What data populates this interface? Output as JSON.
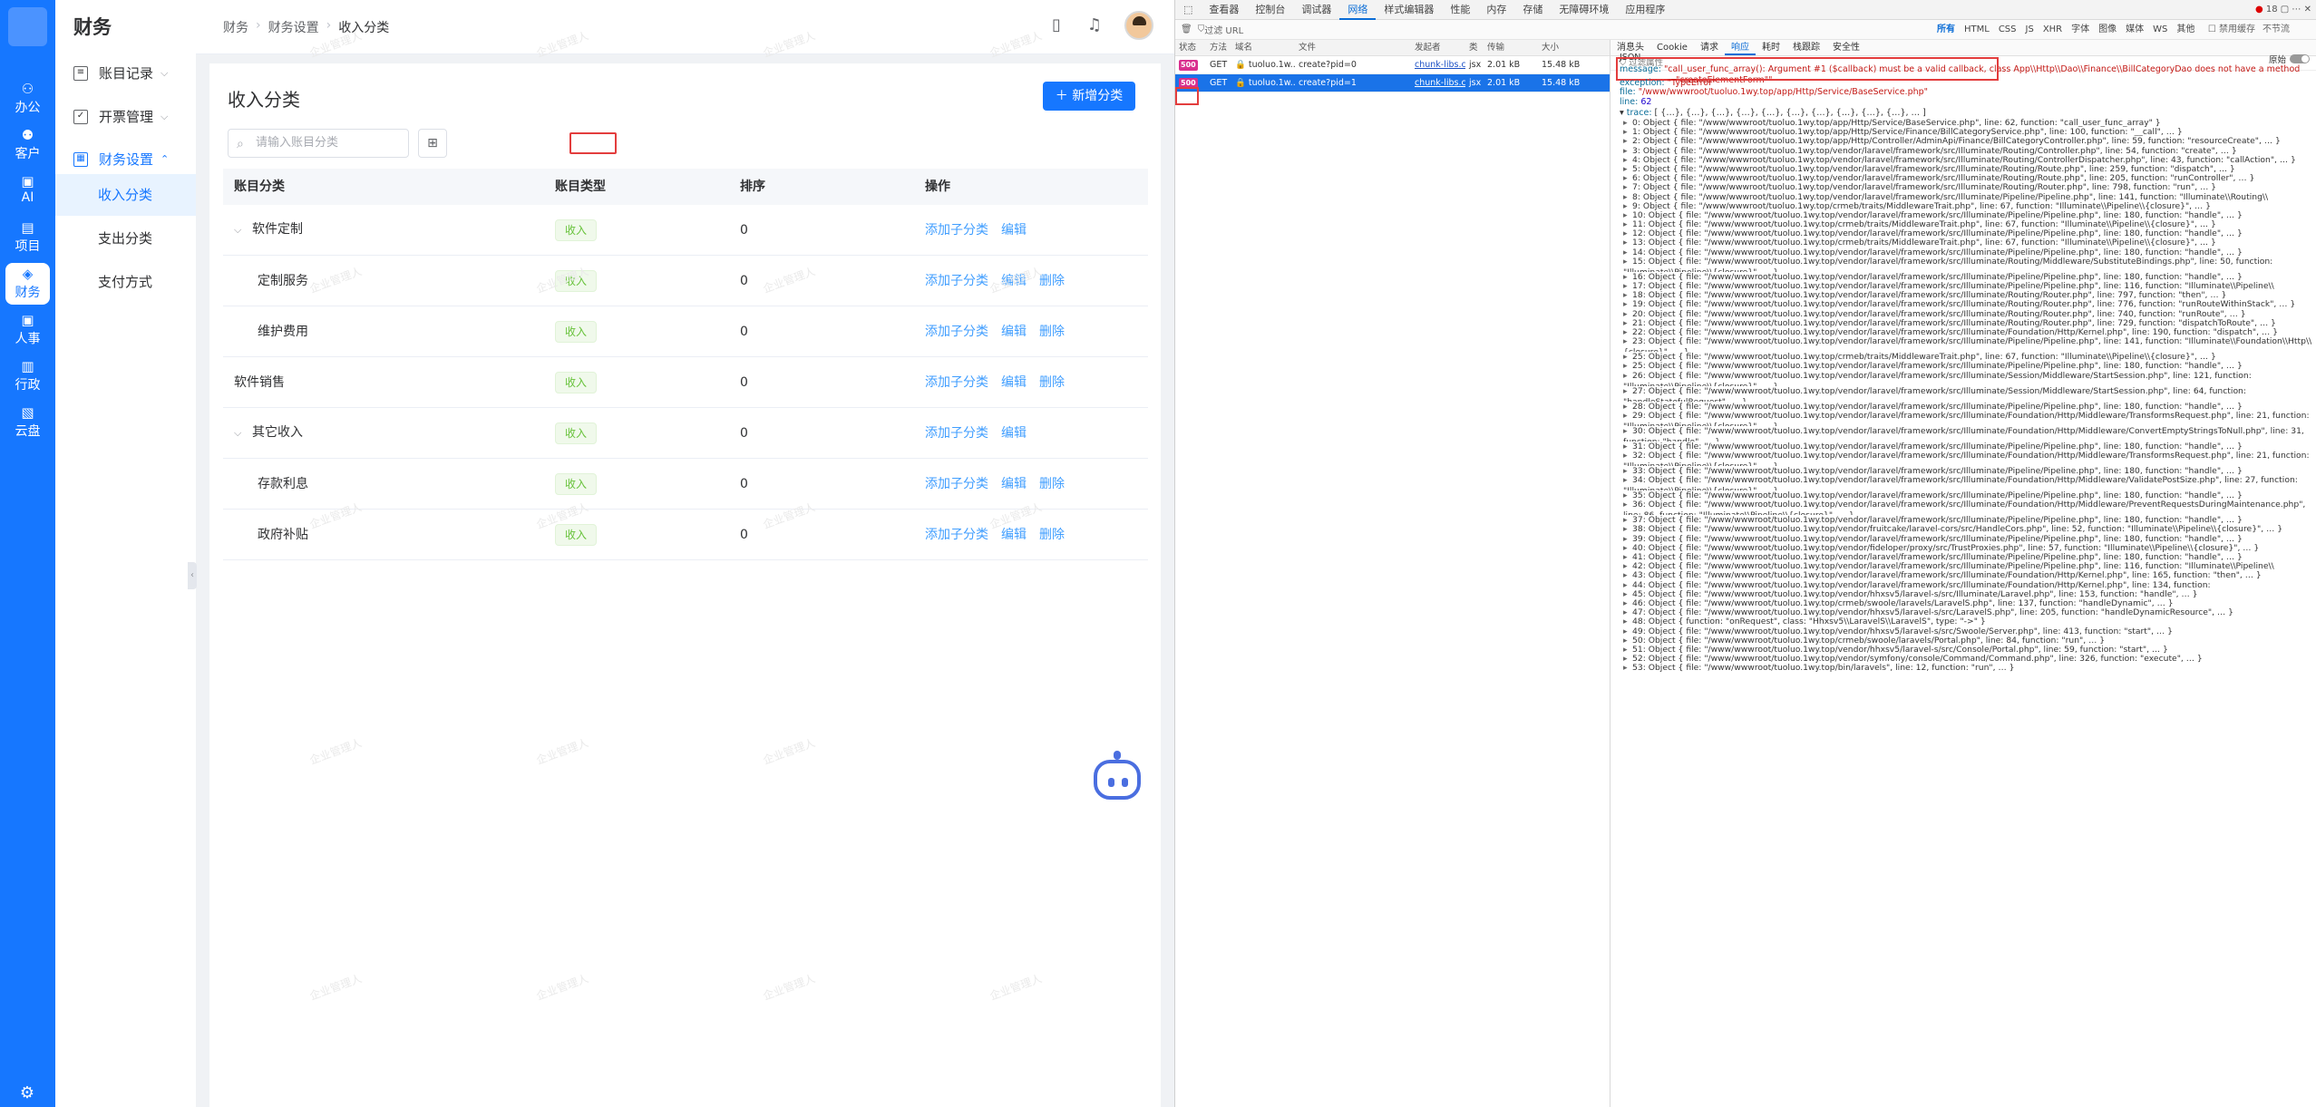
{
  "app": {
    "rail": {
      "items": [
        {
          "label": "办公",
          "icon": "office-icon"
        },
        {
          "label": "客户",
          "icon": "customer-icon"
        },
        {
          "label": "AI",
          "icon": "ai-icon"
        },
        {
          "label": "项目",
          "icon": "project-icon"
        },
        {
          "label": "财务",
          "icon": "finance-icon",
          "active": true
        },
        {
          "label": "人事",
          "icon": "hr-icon"
        },
        {
          "label": "行政",
          "icon": "admin-icon"
        },
        {
          "label": "云盘",
          "icon": "cloud-icon"
        }
      ]
    },
    "subnav": {
      "title": "财务",
      "groups": [
        "账目记录",
        "开票管理",
        "财务设置"
      ],
      "items": [
        "收入分类",
        "支出分类",
        "支付方式"
      ]
    },
    "breadcrumb": [
      "财务",
      "财务设置",
      "收入分类"
    ],
    "page": {
      "title": "收入分类",
      "add_button": "新增分类",
      "search_placeholder": "请输入账目分类"
    },
    "table": {
      "headers": [
        "账目分类",
        "账目类型",
        "排序",
        "操作"
      ],
      "rows": [
        {
          "name": "软件定制",
          "type": "收入",
          "sort": "0",
          "actions": [
            "添加子分类",
            "编辑"
          ],
          "level": 0,
          "expand": true
        },
        {
          "name": "定制服务",
          "type": "收入",
          "sort": "0",
          "actions": [
            "添加子分类",
            "编辑",
            "删除"
          ],
          "level": 1
        },
        {
          "name": "维护费用",
          "type": "收入",
          "sort": "0",
          "actions": [
            "添加子分类",
            "编辑",
            "删除"
          ],
          "level": 1
        },
        {
          "name": "软件销售",
          "type": "收入",
          "sort": "0",
          "actions": [
            "添加子分类",
            "编辑",
            "删除"
          ],
          "level": 0
        },
        {
          "name": "其它收入",
          "type": "收入",
          "sort": "0",
          "actions": [
            "添加子分类",
            "编辑"
          ],
          "level": 0,
          "expand": true
        },
        {
          "name": "存款利息",
          "type": "收入",
          "sort": "0",
          "actions": [
            "添加子分类",
            "编辑",
            "删除"
          ],
          "level": 1
        },
        {
          "name": "政府补贴",
          "type": "收入",
          "sort": "0",
          "actions": [
            "添加子分类",
            "编辑",
            "删除"
          ],
          "level": 1
        }
      ]
    },
    "watermark": "企业管理人"
  },
  "devtools": {
    "tabs": [
      "查看器",
      "控制台",
      "调试器",
      "网络",
      "样式编辑器",
      "性能",
      "内存",
      "存储",
      "无障碍环境",
      "应用程序"
    ],
    "active_tab": "网络",
    "error_count": "18",
    "filter_placeholder": "过滤 URL",
    "types": [
      "所有",
      "HTML",
      "CSS",
      "JS",
      "XHR",
      "字体",
      "图像",
      "媒体",
      "WS",
      "其他"
    ],
    "options": [
      "禁用缓存",
      "不节流"
    ],
    "columns": [
      "状态",
      "方法",
      "域名",
      "文件",
      "发起者",
      "类",
      "传输",
      "大小"
    ],
    "requests": [
      {
        "status": "500",
        "method": "GET",
        "domain": "tuoluo.1w...",
        "file": "create?pid=0",
        "initiator": "chunk-libs.c...",
        "type": "jsx",
        "transfer": "2.01 kB",
        "size": "15.48 kB"
      },
      {
        "status": "500",
        "method": "GET",
        "domain": "tuoluo.1w...",
        "file": "create?pid=1",
        "initiator": "chunk-libs.c...",
        "type": "jsx",
        "transfer": "2.01 kB",
        "size": "15.48 kB",
        "selected": true
      }
    ],
    "resp_tabs": [
      "消息头",
      "Cookie",
      "请求",
      "响应",
      "耗时",
      "栈跟踪",
      "安全性"
    ],
    "active_resp_tab": "响应",
    "resp_filter": "过滤属性",
    "json_label": "JSON",
    "raw_label": "原始",
    "message_key": "message:",
    "message_value": "\"call_user_func_array(): Argument #1 ($callback) must be a valid callback, class App\\\\Http\\\\Dao\\\\Finance\\\\BillCategoryDao does not have a method",
    "message_value2": "\"createElementForm\"\"",
    "exception": "\"TypeError\"",
    "file": "\"/www/wwwroot/tuoluo.1wy.top/app/Http/Service/BaseService.php\"",
    "line": "62",
    "trace_summary": "[ {…}, {…}, {…}, {…}, {…}, {…}, {…}, {…}, {…}, {…}, … ]",
    "trace": [
      "0: Object { file: \"/www/wwwroot/tuoluo.1wy.top/app/Http/Service/BaseService.php\", line: 62, function: \"call_user_func_array\" }",
      "1: Object { file: \"/www/wwwroot/tuoluo.1wy.top/app/Http/Service/Finance/BillCategoryService.php\", line: 100, function: \"__call\", … }",
      "2: Object { file: \"/www/wwwroot/tuoluo.1wy.top/app/Http/Controller/AdminApi/Finance/BillCategoryController.php\", line: 59, function: \"resourceCreate\", … }",
      "3: Object { file: \"/www/wwwroot/tuoluo.1wy.top/vendor/laravel/framework/src/Illuminate/Routing/Controller.php\", line: 54, function: \"create\", … }",
      "4: Object { file: \"/www/wwwroot/tuoluo.1wy.top/vendor/laravel/framework/src/Illuminate/Routing/ControllerDispatcher.php\", line: 43, function: \"callAction\", … }",
      "5: Object { file: \"/www/wwwroot/tuoluo.1wy.top/vendor/laravel/framework/src/Illuminate/Routing/Route.php\", line: 259, function: \"dispatch\", … }",
      "6: Object { file: \"/www/wwwroot/tuoluo.1wy.top/vendor/laravel/framework/src/Illuminate/Routing/Route.php\", line: 205, function: \"runController\", … }",
      "7: Object { file: \"/www/wwwroot/tuoluo.1wy.top/vendor/laravel/framework/src/Illuminate/Routing/Router.php\", line: 798, function: \"run\", … }",
      "8: Object { file: \"/www/wwwroot/tuoluo.1wy.top/vendor/laravel/framework/src/Illuminate/Pipeline/Pipeline.php\", line: 141, function: \"Illuminate\\\\Routing\\\\{closure}\", … }",
      "9: Object { file: \"/www/wwwroot/tuoluo.1wy.top/crmeb/traits/MiddlewareTrait.php\", line: 67, function: \"Illuminate\\\\Pipeline\\\\{closure}\", … }",
      "10: Object { file: \"/www/wwwroot/tuoluo.1wy.top/vendor/laravel/framework/src/Illuminate/Pipeline/Pipeline.php\", line: 180, function: \"handle\", … }",
      "11: Object { file: \"/www/wwwroot/tuoluo.1wy.top/crmeb/traits/MiddlewareTrait.php\", line: 67, function: \"Illuminate\\\\Pipeline\\\\{closure}\", … }",
      "12: Object { file: \"/www/wwwroot/tuoluo.1wy.top/vendor/laravel/framework/src/Illuminate/Pipeline/Pipeline.php\", line: 180, function: \"handle\", … }",
      "13: Object { file: \"/www/wwwroot/tuoluo.1wy.top/crmeb/traits/MiddlewareTrait.php\", line: 67, function: \"Illuminate\\\\Pipeline\\\\{closure}\", … }",
      "14: Object { file: \"/www/wwwroot/tuoluo.1wy.top/vendor/laravel/framework/src/Illuminate/Pipeline/Pipeline.php\", line: 180, function: \"handle\", … }",
      "15: Object { file: \"/www/wwwroot/tuoluo.1wy.top/vendor/laravel/framework/src/Illuminate/Routing/Middleware/SubstituteBindings.php\", line: 50, function: \"Illuminate\\\\Pipeline\\\\{closure}\", … }",
      "16: Object { file: \"/www/wwwroot/tuoluo.1wy.top/vendor/laravel/framework/src/Illuminate/Pipeline/Pipeline.php\", line: 180, function: \"handle\", … }",
      "17: Object { file: \"/www/wwwroot/tuoluo.1wy.top/vendor/laravel/framework/src/Illuminate/Pipeline/Pipeline.php\", line: 116, function: \"Illuminate\\\\Pipeline\\\\{closure}\", … }",
      "18: Object { file: \"/www/wwwroot/tuoluo.1wy.top/vendor/laravel/framework/src/Illuminate/Routing/Router.php\", line: 797, function: \"then\", … }",
      "19: Object { file: \"/www/wwwroot/tuoluo.1wy.top/vendor/laravel/framework/src/Illuminate/Routing/Router.php\", line: 776, function: \"runRouteWithinStack\", … }",
      "20: Object { file: \"/www/wwwroot/tuoluo.1wy.top/vendor/laravel/framework/src/Illuminate/Routing/Router.php\", line: 740, function: \"runRoute\", … }",
      "21: Object { file: \"/www/wwwroot/tuoluo.1wy.top/vendor/laravel/framework/src/Illuminate/Routing/Router.php\", line: 729, function: \"dispatchToRoute\", … }",
      "22: Object { file: \"/www/wwwroot/tuoluo.1wy.top/vendor/laravel/framework/src/Illuminate/Foundation/Http/Kernel.php\", line: 190, function: \"dispatch\", … }",
      "23: Object { file: \"/www/wwwroot/tuoluo.1wy.top/vendor/laravel/framework/src/Illuminate/Pipeline/Pipeline.php\", line: 141, function: \"Illuminate\\\\Foundation\\\\Http\\\\{closure}\", … }",
      "25: Object { file: \"/www/wwwroot/tuoluo.1wy.top/crmeb/traits/MiddlewareTrait.php\", line: 67, function: \"Illuminate\\\\Pipeline\\\\{closure}\", … }",
      "25: Object { file: \"/www/wwwroot/tuoluo.1wy.top/vendor/laravel/framework/src/Illuminate/Pipeline/Pipeline.php\", line: 180, function: \"handle\", … }",
      "26: Object { file: \"/www/wwwroot/tuoluo.1wy.top/vendor/laravel/framework/src/Illuminate/Session/Middleware/StartSession.php\", line: 121, function: \"Illuminate\\\\Pipeline\\\\{closure}\", … }",
      "27: Object { file: \"/www/wwwroot/tuoluo.1wy.top/vendor/laravel/framework/src/Illuminate/Session/Middleware/StartSession.php\", line: 64, function: \"handleStatefulRequest\", … }",
      "28: Object { file: \"/www/wwwroot/tuoluo.1wy.top/vendor/laravel/framework/src/Illuminate/Pipeline/Pipeline.php\", line: 180, function: \"handle\", … }",
      "29: Object { file: \"/www/wwwroot/tuoluo.1wy.top/vendor/laravel/framework/src/Illuminate/Foundation/Http/Middleware/TransformsRequest.php\", line: 21, function: \"Illuminate\\\\Pipeline\\\\{closure}\", … }",
      "30: Object { file: \"/www/wwwroot/tuoluo.1wy.top/vendor/laravel/framework/src/Illuminate/Foundation/Http/Middleware/ConvertEmptyStringsToNull.php\", line: 31, function: \"handle\", … }",
      "31: Object { file: \"/www/wwwroot/tuoluo.1wy.top/vendor/laravel/framework/src/Illuminate/Pipeline/Pipeline.php\", line: 180, function: \"handle\", … }",
      "32: Object { file: \"/www/wwwroot/tuoluo.1wy.top/vendor/laravel/framework/src/Illuminate/Foundation/Http/Middleware/TransformsRequest.php\", line: 21, function: \"Illuminate\\\\Pipeline\\\\{closure}\", … }",
      "33: Object { file: \"/www/wwwroot/tuoluo.1wy.top/vendor/laravel/framework/src/Illuminate/Pipeline/Pipeline.php\", line: 180, function: \"handle\", … }",
      "34: Object { file: \"/www/wwwroot/tuoluo.1wy.top/vendor/laravel/framework/src/Illuminate/Foundation/Http/Middleware/ValidatePostSize.php\", line: 27, function: \"Illuminate\\\\Pipeline\\\\{closure}\", … }",
      "35: Object { file: \"/www/wwwroot/tuoluo.1wy.top/vendor/laravel/framework/src/Illuminate/Pipeline/Pipeline.php\", line: 180, function: \"handle\", … }",
      "36: Object { file: \"/www/wwwroot/tuoluo.1wy.top/vendor/laravel/framework/src/Illuminate/Foundation/Http/Middleware/PreventRequestsDuringMaintenance.php\", line: 86, function: \"Illuminate\\\\Pipeline\\\\{closure}\", … }",
      "37: Object { file: \"/www/wwwroot/tuoluo.1wy.top/vendor/laravel/framework/src/Illuminate/Pipeline/Pipeline.php\", line: 180, function: \"handle\", … }",
      "38: Object { file: \"/www/wwwroot/tuoluo.1wy.top/vendor/fruitcake/laravel-cors/src/HandleCors.php\", line: 52, function: \"Illuminate\\\\Pipeline\\\\{closure}\", … }",
      "39: Object { file: \"/www/wwwroot/tuoluo.1wy.top/vendor/laravel/framework/src/Illuminate/Pipeline/Pipeline.php\", line: 180, function: \"handle\", … }",
      "40: Object { file: \"/www/wwwroot/tuoluo.1wy.top/vendor/fideloper/proxy/src/TrustProxies.php\", line: 57, function: \"Illuminate\\\\Pipeline\\\\{closure}\", … }",
      "41: Object { file: \"/www/wwwroot/tuoluo.1wy.top/vendor/laravel/framework/src/Illuminate/Pipeline/Pipeline.php\", line: 180, function: \"handle\", … }",
      "42: Object { file: \"/www/wwwroot/tuoluo.1wy.top/vendor/laravel/framework/src/Illuminate/Pipeline/Pipeline.php\", line: 116, function: \"Illuminate\\\\Pipeline\\\\{closure}\", … }",
      "43: Object { file: \"/www/wwwroot/tuoluo.1wy.top/vendor/laravel/framework/src/Illuminate/Foundation/Http/Kernel.php\", line: 165, function: \"then\", … }",
      "44: Object { file: \"/www/wwwroot/tuoluo.1wy.top/vendor/laravel/framework/src/Illuminate/Foundation/Http/Kernel.php\", line: 134, function: \"sendRequestThroughRouter\", … }",
      "45: Object { file: \"/www/wwwroot/tuoluo.1wy.top/vendor/hhxsv5/laravel-s/src/Illuminate/Laravel.php\", line: 153, function: \"handle\", … }",
      "46: Object { file: \"/www/wwwroot/tuoluo.1wy.top/crmeb/swoole/laravels/LaravelS.php\", line: 137, function: \"handleDynamic\", … }",
      "47: Object { file: \"/www/wwwroot/tuoluo.1wy.top/vendor/hhxsv5/laravel-s/src/LaravelS.php\", line: 205, function: \"handleDynamicResource\", … }",
      "48: Object { function: \"onRequest\", class: \"Hhxsv5\\\\LaravelS\\\\LaravelS\", type: \"->\" }",
      "49: Object { file: \"/www/wwwroot/tuoluo.1wy.top/vendor/hhxsv5/laravel-s/src/Swoole/Server.php\", line: 413, function: \"start\", … }",
      "50: Object { file: \"/www/wwwroot/tuoluo.1wy.top/crmeb/swoole/laravels/Portal.php\", line: 84, function: \"run\", … }",
      "51: Object { file: \"/www/wwwroot/tuoluo.1wy.top/vendor/hhxsv5/laravel-s/src/Console/Portal.php\", line: 59, function: \"start\", … }",
      "52: Object { file: \"/www/wwwroot/tuoluo.1wy.top/vendor/symfony/console/Command/Command.php\", line: 326, function: \"execute\", … }",
      "53: Object { file: \"/www/wwwroot/tuoluo.1wy.top/bin/laravels\", line: 12, function: \"run\", … }"
    ]
  }
}
